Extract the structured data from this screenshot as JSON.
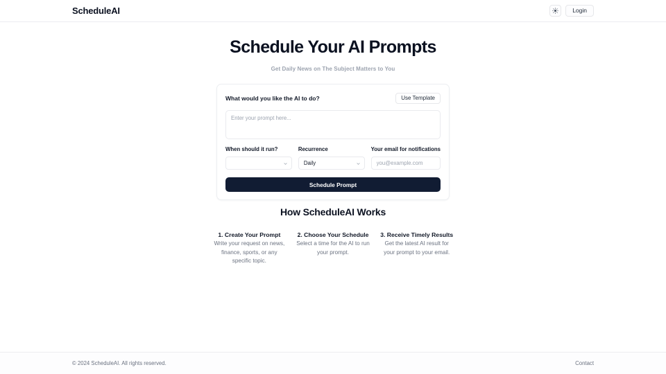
{
  "navbar": {
    "brand": "ScheduleAI",
    "theme_toggle_icon": "sun-icon",
    "login_label": "Login"
  },
  "hero": {
    "title": "Schedule Your AI Prompts",
    "subtitle": "Get Daily News on The Subject Matters to You"
  },
  "card": {
    "prompt_label": "What would you like the AI to do?",
    "use_template_label": "Use Template",
    "prompt_placeholder": "Enter your prompt here...",
    "prompt_value": "",
    "fields": {
      "when_label": "When should it run?",
      "when_value": "",
      "recurrence_label": "Recurrence",
      "recurrence_value": "Daily",
      "email_label": "Your email for notifications",
      "email_placeholder": "you@example.com",
      "email_value": ""
    },
    "submit_label": "Schedule Prompt",
    "submit_color": "#111c33"
  },
  "how": {
    "heading": "How ScheduleAI Works",
    "steps": [
      {
        "title": "1. Create Your Prompt",
        "desc": "Write your request on news, finance, sports, or any specific topic."
      },
      {
        "title": "2. Choose Your Schedule",
        "desc": "Select a time for the AI to run your prompt."
      },
      {
        "title": "3. Receive Timely Results",
        "desc": "Get the latest AI result for your prompt to your email."
      }
    ]
  },
  "footer": {
    "copyright": "© 2024 ScheduleAI. All rights reserved.",
    "contact_label": "Contact"
  }
}
